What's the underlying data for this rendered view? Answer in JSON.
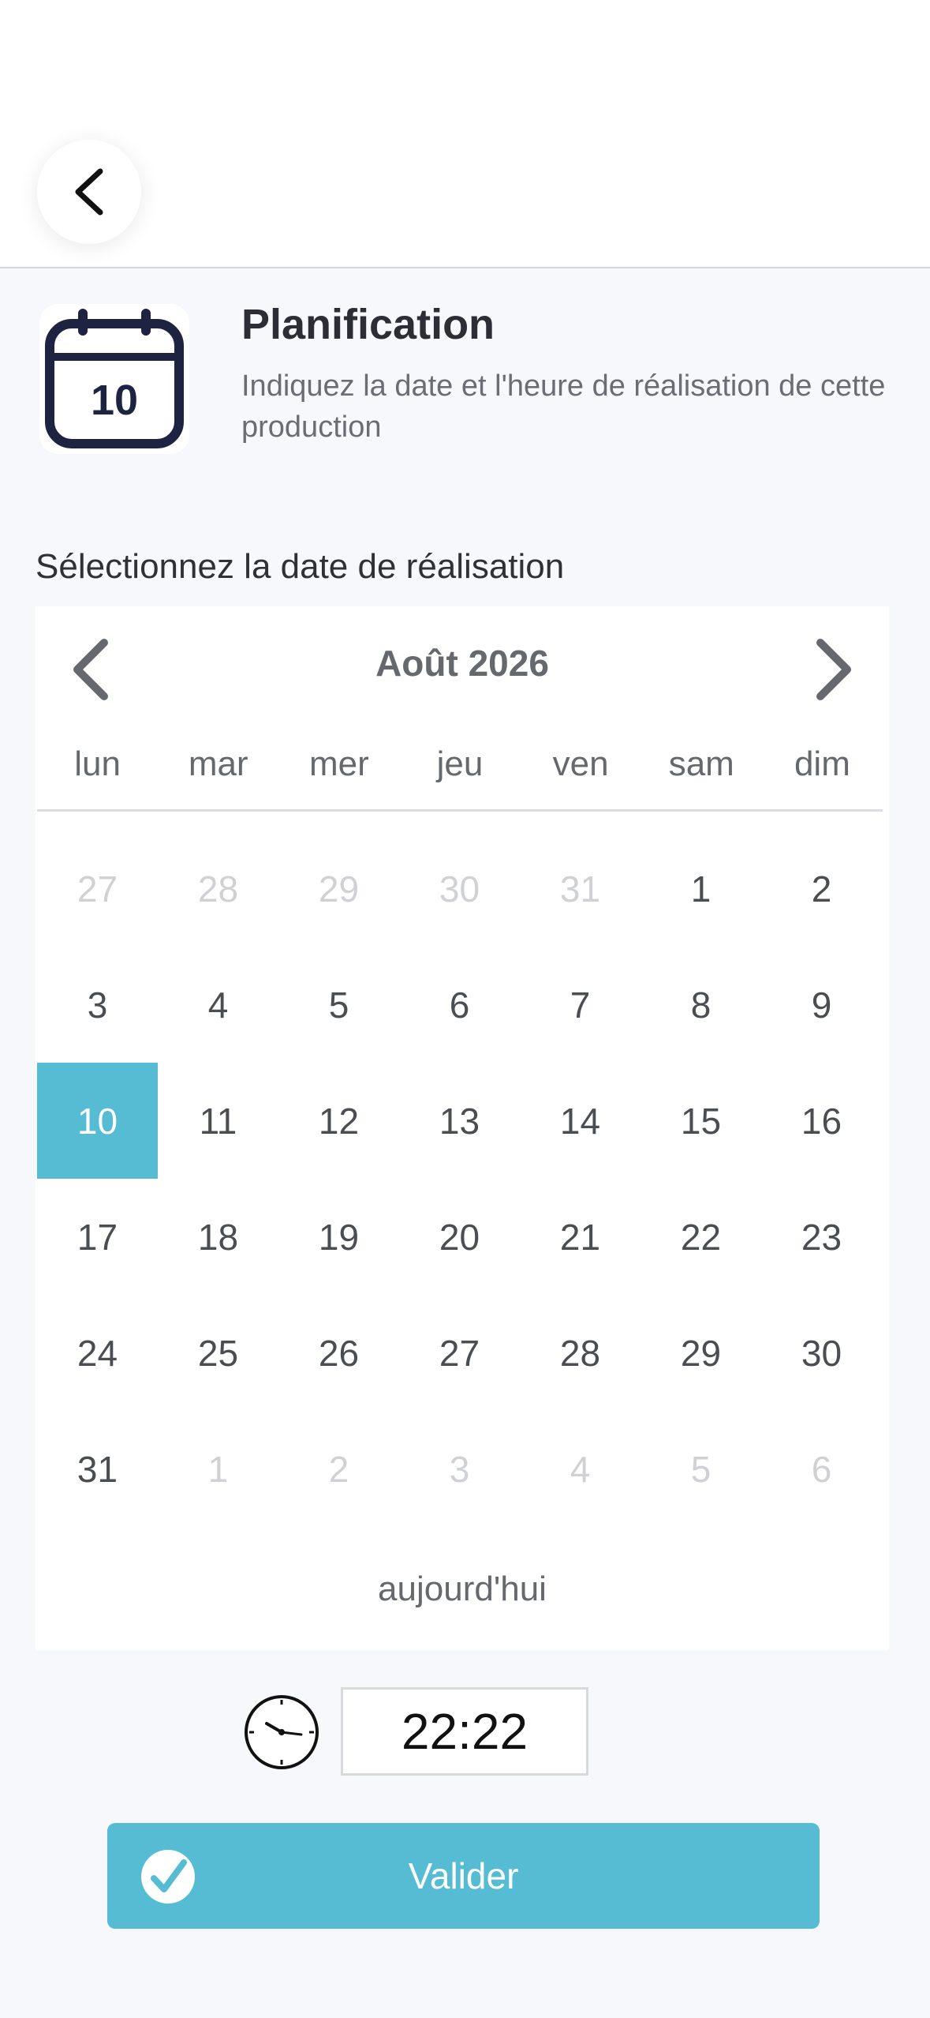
{
  "header": {
    "back_icon": "chevron-left-icon",
    "icon": "calendar-icon",
    "icon_day": "10",
    "title": "Planification",
    "subtitle": "Indiquez la date et l'heure de réalisation de cette production"
  },
  "date_section": {
    "label": "Sélectionnez la date de réalisation"
  },
  "calendar": {
    "month_label": "Août 2026",
    "prev_icon": "chevron-left-icon",
    "next_icon": "chevron-right-icon",
    "weekdays": [
      "lun",
      "mar",
      "mer",
      "jeu",
      "ven",
      "sam",
      "dim"
    ],
    "weeks": [
      [
        {
          "d": "27",
          "muted": true
        },
        {
          "d": "28",
          "muted": true
        },
        {
          "d": "29",
          "muted": true
        },
        {
          "d": "30",
          "muted": true
        },
        {
          "d": "31",
          "muted": true
        },
        {
          "d": "1"
        },
        {
          "d": "2"
        }
      ],
      [
        {
          "d": "3"
        },
        {
          "d": "4"
        },
        {
          "d": "5"
        },
        {
          "d": "6"
        },
        {
          "d": "7"
        },
        {
          "d": "8"
        },
        {
          "d": "9"
        }
      ],
      [
        {
          "d": "10",
          "selected": true
        },
        {
          "d": "11"
        },
        {
          "d": "12"
        },
        {
          "d": "13"
        },
        {
          "d": "14"
        },
        {
          "d": "15"
        },
        {
          "d": "16"
        }
      ],
      [
        {
          "d": "17"
        },
        {
          "d": "18"
        },
        {
          "d": "19"
        },
        {
          "d": "20"
        },
        {
          "d": "21"
        },
        {
          "d": "22"
        },
        {
          "d": "23"
        }
      ],
      [
        {
          "d": "24"
        },
        {
          "d": "25"
        },
        {
          "d": "26"
        },
        {
          "d": "27"
        },
        {
          "d": "28"
        },
        {
          "d": "29"
        },
        {
          "d": "30"
        }
      ],
      [
        {
          "d": "31"
        },
        {
          "d": "1",
          "muted": true
        },
        {
          "d": "2",
          "muted": true
        },
        {
          "d": "3",
          "muted": true
        },
        {
          "d": "4",
          "muted": true
        },
        {
          "d": "5",
          "muted": true
        },
        {
          "d": "6",
          "muted": true
        }
      ]
    ],
    "today_label": "aujourd'hui",
    "selected_color": "#55bcd3"
  },
  "time": {
    "icon": "clock-icon",
    "value": "22:22"
  },
  "actions": {
    "validate_label": "Valider",
    "validate_icon": "checkmark-circle-icon",
    "button_color": "#55bcd3"
  }
}
